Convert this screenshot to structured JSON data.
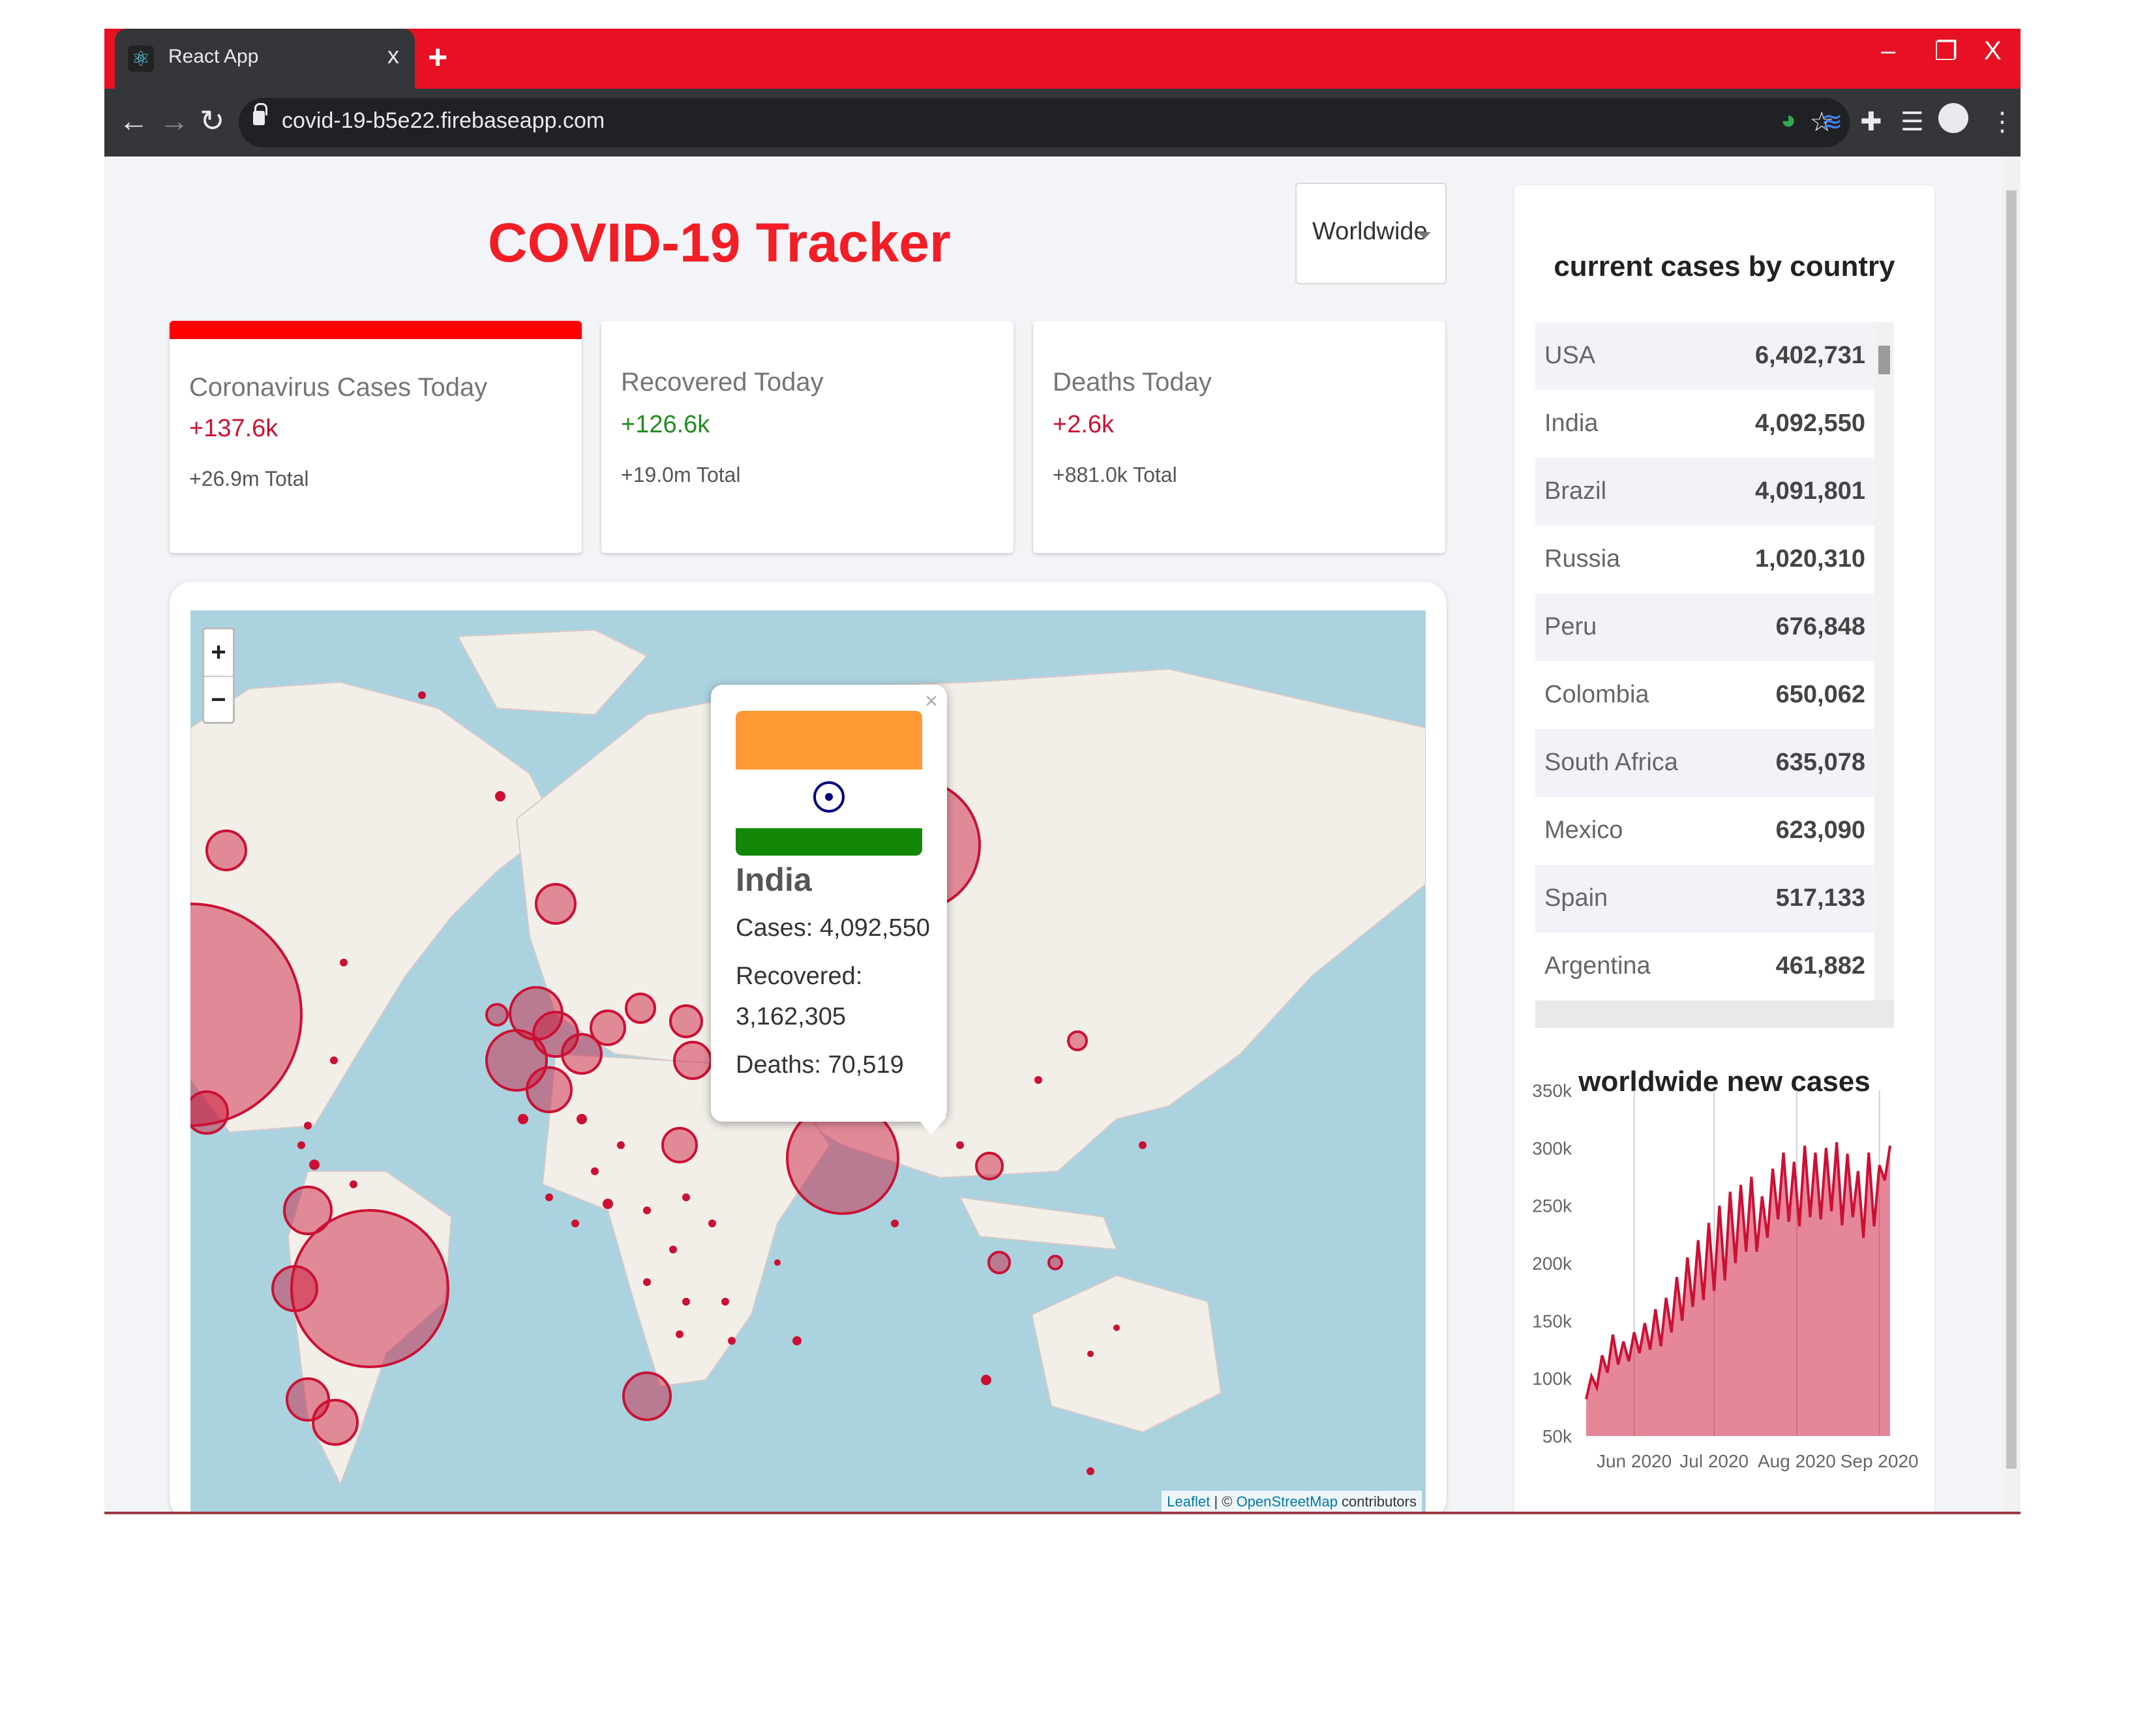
{
  "browser": {
    "tab_title": "React App",
    "tab_close": "x",
    "new_tab": "+",
    "url": "covid-19-b5e22.firebaseapp.com",
    "minimize": "–",
    "restore": "❐",
    "close": "X"
  },
  "header": {
    "title": "COVID-19 Tracker",
    "country_select": "Worldwide"
  },
  "info_cards": [
    {
      "title": "Coronavirus Cases Today",
      "value": "+137.6k",
      "total": "+26.9m Total",
      "color": "#cc1034",
      "selected": true
    },
    {
      "title": "Recovered Today",
      "value": "+126.6k",
      "total": "+19.0m Total",
      "color": "#228b22",
      "selected": false
    },
    {
      "title": "Deaths Today",
      "value": "+2.6k",
      "total": "+881.0k Total",
      "color": "#cc1034",
      "selected": false
    }
  ],
  "map": {
    "zoom_in": "+",
    "zoom_out": "−",
    "attribution": {
      "leaflet": "Leaflet",
      "sep": " | © ",
      "osm": "OpenStreetMap",
      "tail": " contributors"
    },
    "popup": {
      "close": "×",
      "country": "India",
      "cases": "Cases: 4,092,550",
      "recovered_label": "Recovered:",
      "recovered_value": "3,162,305",
      "deaths": "Deaths: 70,519"
    }
  },
  "sidebar": {
    "table_title": "current cases by country",
    "countries": [
      {
        "name": "USA",
        "cases": "6,402,731"
      },
      {
        "name": "India",
        "cases": "4,092,550"
      },
      {
        "name": "Brazil",
        "cases": "4,091,801"
      },
      {
        "name": "Russia",
        "cases": "1,020,310"
      },
      {
        "name": "Peru",
        "cases": "676,848"
      },
      {
        "name": "Colombia",
        "cases": "650,062"
      },
      {
        "name": "South Africa",
        "cases": "635,078"
      },
      {
        "name": "Mexico",
        "cases": "623,090"
      },
      {
        "name": "Spain",
        "cases": "517,133"
      },
      {
        "name": "Argentina",
        "cases": "461,882"
      }
    ],
    "chart_title": "worldwide new cases"
  },
  "chart_data": {
    "type": "area",
    "title": "worldwide new cases",
    "xlabel": "",
    "ylabel": "",
    "ylim": [
      50000,
      350000
    ],
    "y_ticks": [
      "350k",
      "300k",
      "250k",
      "200k",
      "150k",
      "100k",
      "50k"
    ],
    "x_ticks": [
      "Jun 2020",
      "Jul 2020",
      "Aug 2020",
      "Sep 2020"
    ],
    "x_tick_days": [
      18,
      48,
      79,
      110
    ],
    "grid": "vertical",
    "color": "#cc1034",
    "fill": "rgba(204,16,52,0.5)",
    "x": [
      "May 14",
      "May 16",
      "May 18",
      "May 20",
      "May 22",
      "May 24",
      "May 26",
      "May 28",
      "May 30",
      "Jun 1",
      "Jun 3",
      "Jun 5",
      "Jun 7",
      "Jun 9",
      "Jun 11",
      "Jun 13",
      "Jun 15",
      "Jun 17",
      "Jun 19",
      "Jun 21",
      "Jun 23",
      "Jun 25",
      "Jun 27",
      "Jun 29",
      "Jul 1",
      "Jul 3",
      "Jul 5",
      "Jul 7",
      "Jul 9",
      "Jul 11",
      "Jul 13",
      "Jul 15",
      "Jul 17",
      "Jul 19",
      "Jul 21",
      "Jul 23",
      "Jul 25",
      "Jul 27",
      "Jul 29",
      "Jul 31",
      "Aug 2",
      "Aug 4",
      "Aug 6",
      "Aug 8",
      "Aug 10",
      "Aug 12",
      "Aug 14",
      "Aug 16",
      "Aug 18",
      "Aug 20",
      "Aug 22",
      "Aug 24",
      "Aug 26",
      "Aug 28",
      "Aug 30",
      "Sep 1",
      "Sep 3",
      "Sep 5"
    ],
    "values": [
      82000,
      102000,
      92000,
      120000,
      105000,
      138000,
      112000,
      132000,
      115000,
      140000,
      122000,
      148000,
      125000,
      160000,
      128000,
      170000,
      140000,
      188000,
      150000,
      205000,
      162000,
      220000,
      168000,
      235000,
      176000,
      250000,
      185000,
      262000,
      200000,
      268000,
      210000,
      275000,
      210000,
      258000,
      222000,
      282000,
      238000,
      296000,
      236000,
      288000,
      232000,
      302000,
      240000,
      296000,
      238000,
      300000,
      245000,
      305000,
      233000,
      295000,
      240000,
      280000,
      222000,
      296000,
      232000,
      285000,
      272000,
      302000
    ]
  }
}
